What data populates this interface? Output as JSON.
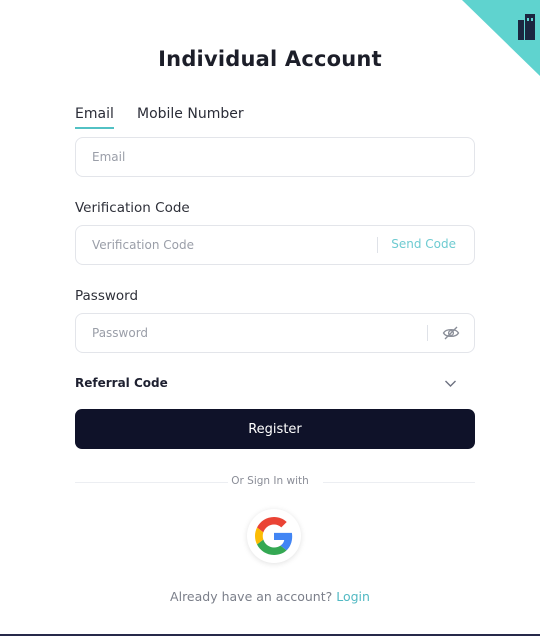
{
  "title": "Individual Account",
  "tabs": [
    {
      "label": "Email",
      "active": true
    },
    {
      "label": "Mobile Number",
      "active": false
    }
  ],
  "email": {
    "placeholder": "Email",
    "value": ""
  },
  "verification": {
    "label": "Verification Code",
    "placeholder": "Verification Code",
    "value": "",
    "send_code_label": "Send Code"
  },
  "password": {
    "label": "Password",
    "placeholder": "Password",
    "value": "",
    "icon": "eye-slash-icon"
  },
  "referral": {
    "label": "Referral Code",
    "icon": "chevron-down-icon"
  },
  "register_label": "Register",
  "social": {
    "divider_text": "Or Sign In with",
    "provider_icon": "google-icon"
  },
  "footer": {
    "prompt": "Already have an account?",
    "login_label": "Login"
  },
  "colors": {
    "accent": "#52c1c4",
    "button": "#0f1229",
    "corner": "#5fd3cf"
  }
}
